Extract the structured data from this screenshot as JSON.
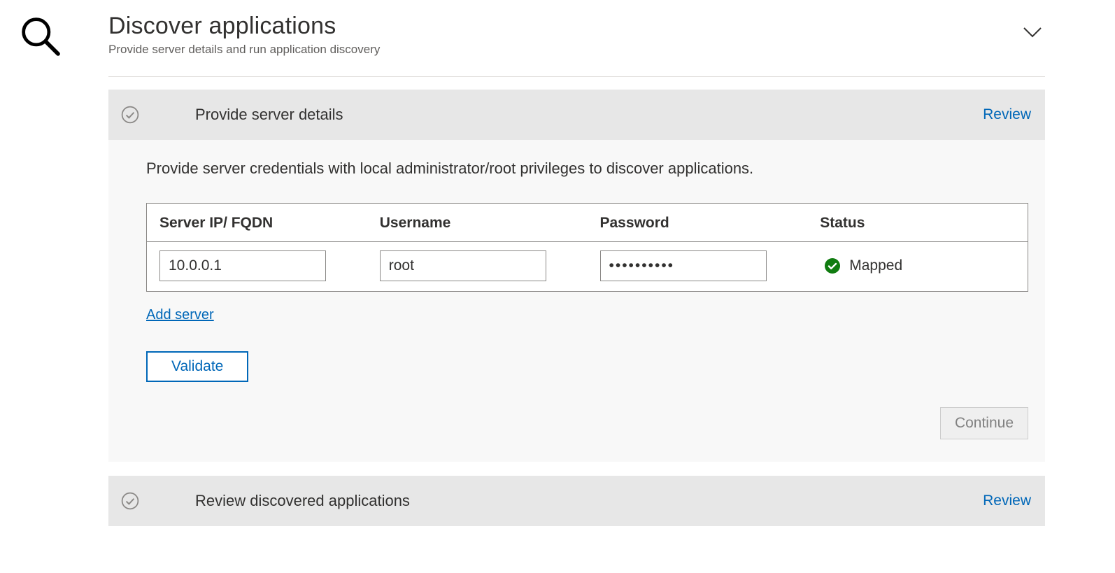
{
  "header": {
    "title": "Discover applications",
    "subtitle": "Provide server details and run application discovery"
  },
  "sections": {
    "provide": {
      "title": "Provide server details",
      "review_label": "Review",
      "instruction": "Provide server credentials with local administrator/root privileges to discover applications.",
      "columns": {
        "ip": "Server IP/ FQDN",
        "username": "Username",
        "password": "Password",
        "status": "Status"
      },
      "rows": [
        {
          "ip": "10.0.0.1",
          "username": "root",
          "password": "••••••••••",
          "status": "Mapped"
        }
      ],
      "add_server_label": "Add server",
      "validate_label": "Validate",
      "continue_label": "Continue"
    },
    "review_discovered": {
      "title": "Review discovered applications",
      "review_label": "Review"
    }
  },
  "colors": {
    "link": "#0067B8",
    "success": "#107C10"
  }
}
